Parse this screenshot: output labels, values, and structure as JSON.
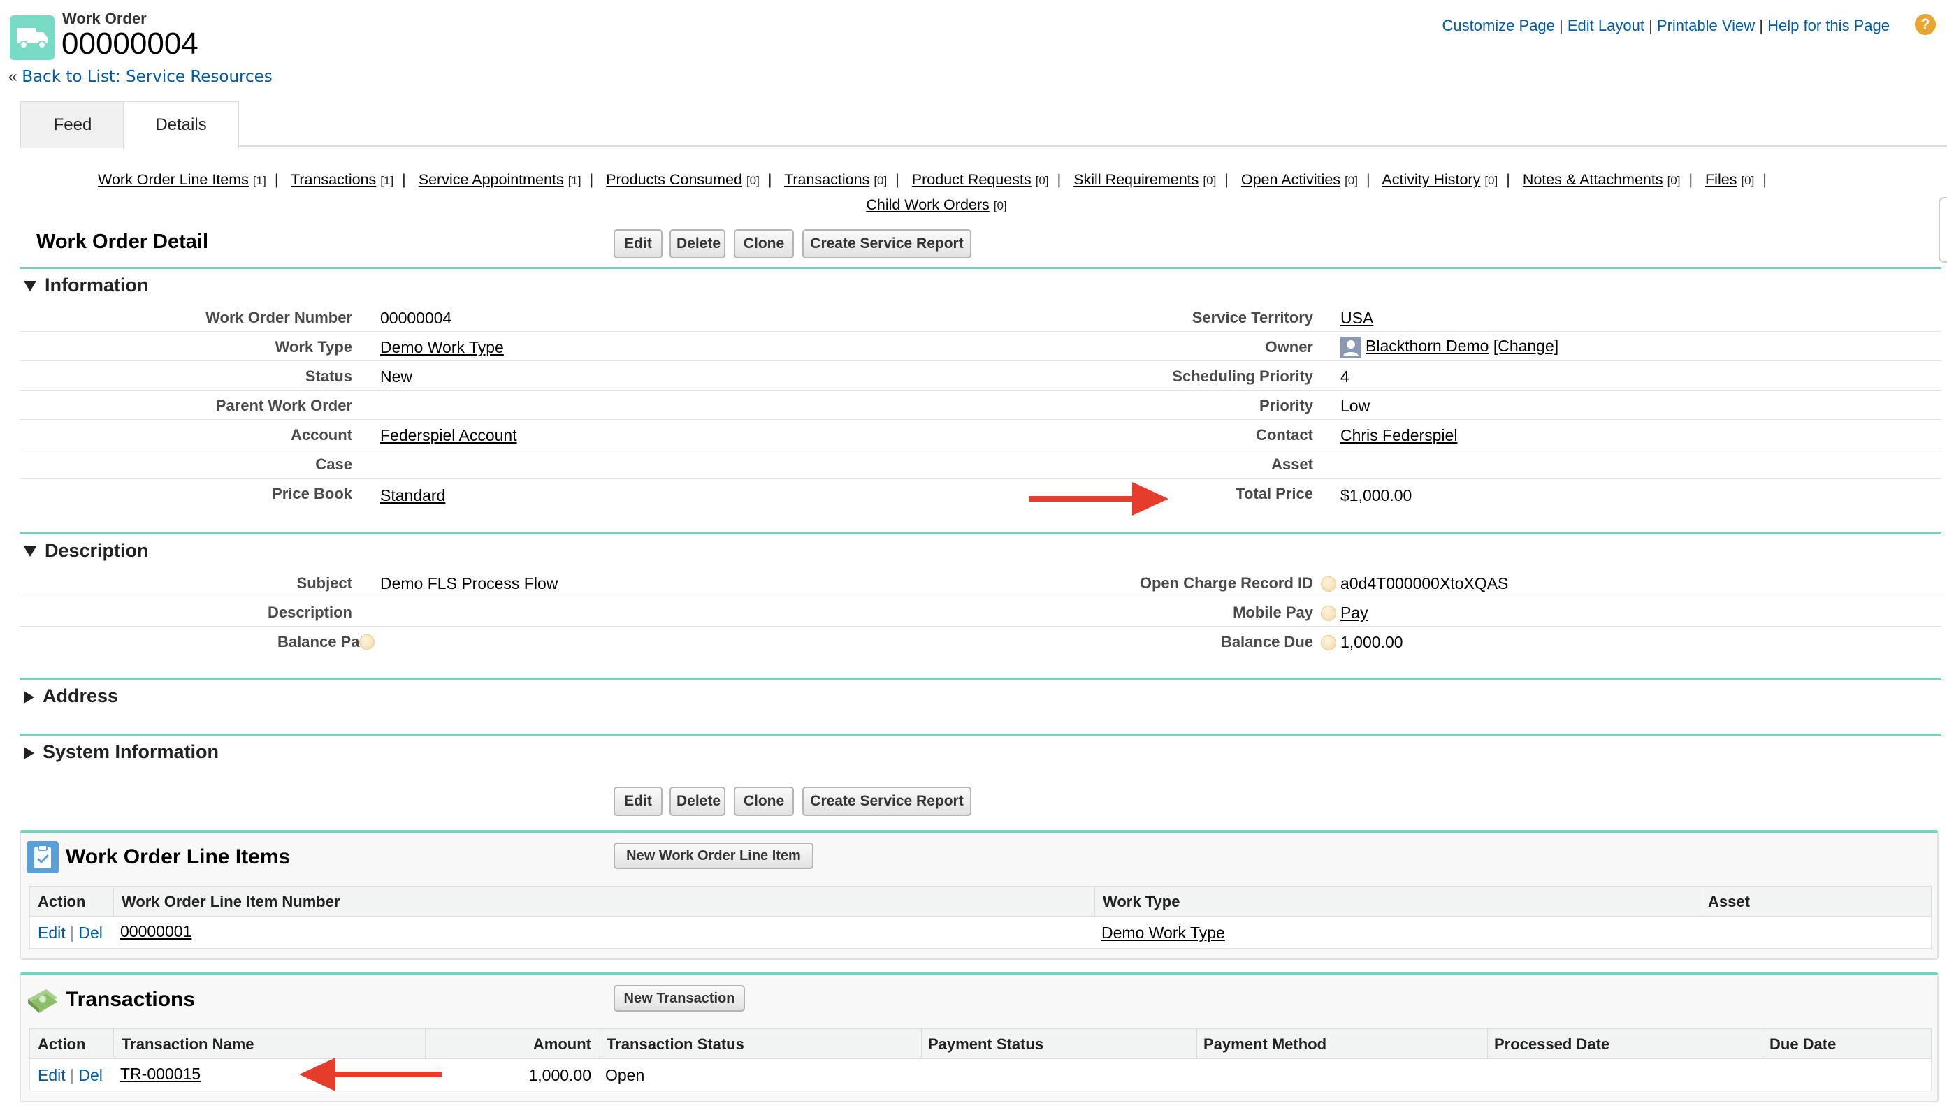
{
  "header": {
    "object_label": "Work Order",
    "record_number": "00000004",
    "back_prefix": "«",
    "back_link": "Back to List: Service Resources",
    "top_links": [
      "Customize Page",
      "Edit Layout",
      "Printable View",
      "Help for this Page"
    ],
    "link_sep": "|",
    "help_icon": "?"
  },
  "tabs": [
    "Feed",
    "Details"
  ],
  "related_links": [
    {
      "label": "Work Order Line Items",
      "count": "[1]"
    },
    {
      "label": "Transactions",
      "count": "[1]"
    },
    {
      "label": "Service Appointments",
      "count": "[1]"
    },
    {
      "label": "Products Consumed",
      "count": "[0]"
    },
    {
      "label": "Transactions",
      "count": "[0]"
    },
    {
      "label": "Product Requests",
      "count": "[0]"
    },
    {
      "label": "Skill Requirements",
      "count": "[0]"
    },
    {
      "label": "Open Activities",
      "count": "[0]"
    },
    {
      "label": "Activity History",
      "count": "[0]"
    },
    {
      "label": "Notes & Attachments",
      "count": "[0]"
    },
    {
      "label": "Files",
      "count": "[0]"
    },
    {
      "label": "Child Work Orders",
      "count": "[0]"
    }
  ],
  "detail": {
    "title": "Work Order Detail",
    "buttons": [
      "Edit",
      "Delete",
      "Clone",
      "Create Service Report"
    ]
  },
  "information": {
    "title": "Information",
    "left": [
      {
        "label": "Work Order Number",
        "value": "00000004"
      },
      {
        "label": "Work Type",
        "value": "Demo Work Type"
      },
      {
        "label": "Status",
        "value": "New"
      },
      {
        "label": "Parent Work Order",
        "value": ""
      },
      {
        "label": "Account",
        "value": "Federspiel Account"
      },
      {
        "label": "Case",
        "value": ""
      },
      {
        "label": "Price Book",
        "value": "Standard"
      }
    ],
    "right": [
      {
        "label": "Service Territory",
        "value": "USA"
      },
      {
        "label": "Owner",
        "value": "Blackthorn Demo",
        "extra": "[Change]"
      },
      {
        "label": "Scheduling Priority",
        "value": "4"
      },
      {
        "label": "Priority",
        "value": "Low"
      },
      {
        "label": "Contact",
        "value": "Chris Federspiel"
      },
      {
        "label": "Asset",
        "value": ""
      },
      {
        "label": "Total Price",
        "value": "$1,000.00"
      }
    ]
  },
  "description": {
    "title": "Description",
    "left": [
      {
        "label": "Subject",
        "value": "Demo FLS Process Flow"
      },
      {
        "label": "Description",
        "value": ""
      },
      {
        "label": "Balance Paid",
        "value": ""
      }
    ],
    "right": [
      {
        "label": "Open Charge Record ID",
        "value": "a0d4T000000XtoXQAS"
      },
      {
        "label": "Mobile Pay",
        "value": "Pay"
      },
      {
        "label": "Balance Due",
        "value": "1,000.00"
      }
    ]
  },
  "collapsed_sections": [
    "Address",
    "System Information"
  ],
  "line_items": {
    "title": "Work Order Line Items",
    "new_button": "New Work Order Line Item",
    "columns": [
      "Action",
      "Work Order Line Item Number",
      "Work Type",
      "Asset"
    ],
    "rows": [
      {
        "edit": "Edit",
        "del": "Del",
        "number": "00000001",
        "work_type": "Demo Work Type",
        "asset": ""
      }
    ]
  },
  "transactions": {
    "title": "Transactions",
    "new_button": "New Transaction",
    "columns": [
      "Action",
      "Transaction Name",
      "Amount",
      "Transaction Status",
      "Payment Status",
      "Payment Method",
      "Processed Date",
      "Due Date"
    ],
    "rows": [
      {
        "edit": "Edit",
        "del": "Del",
        "name": "TR-000015",
        "amount": "1,000.00",
        "status": "Open"
      }
    ]
  },
  "colors": {
    "accent": "#75d1bc",
    "arrow": "#e53c2c",
    "icon_bg": "#78dbc6",
    "link_blue": "#015ba7"
  }
}
